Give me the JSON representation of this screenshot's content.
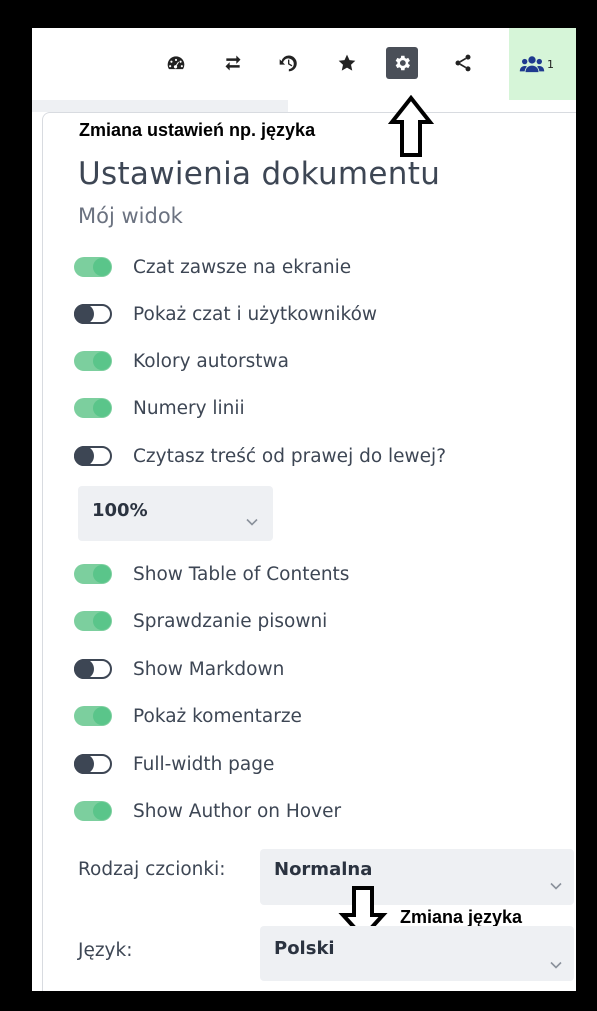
{
  "toolbar": {
    "icons": [
      "dashboard-icon",
      "swap-icon",
      "history-icon",
      "star-icon",
      "gear-icon",
      "share-icon"
    ],
    "users_count": "1"
  },
  "annotations": {
    "top": "Zmiana ustawień np. języka",
    "bottom": "Zmiana języka"
  },
  "panel": {
    "title": "Ustawienia dokumentu",
    "section": "Mój widok",
    "toggles": [
      {
        "label": "Czat zawsze na ekranie",
        "on": true
      },
      {
        "label": "Pokaż czat i użytkowników",
        "on": false
      },
      {
        "label": "Kolory autorstwa",
        "on": true
      },
      {
        "label": "Numery linii",
        "on": true
      },
      {
        "label": "Czytasz treść od prawej do lewej?",
        "on": false
      },
      {
        "label": "Show Table of Contents",
        "on": true
      },
      {
        "label": "Sprawdzanie pisowni",
        "on": true
      },
      {
        "label": "Show Markdown",
        "on": false
      },
      {
        "label": "Pokaż komentarze",
        "on": true
      },
      {
        "label": "Full-width page",
        "on": false
      },
      {
        "label": "Show Author on Hover",
        "on": true
      }
    ],
    "zoom": "100%",
    "font": {
      "label": "Rodzaj czcionki:",
      "value": "Normalna"
    },
    "language": {
      "label": "Język:",
      "value": "Polski"
    }
  },
  "colors": {
    "toggle_on": "#5ac58a",
    "toggle_off": "#3d4654",
    "users_bg": "#d6f5d8"
  }
}
